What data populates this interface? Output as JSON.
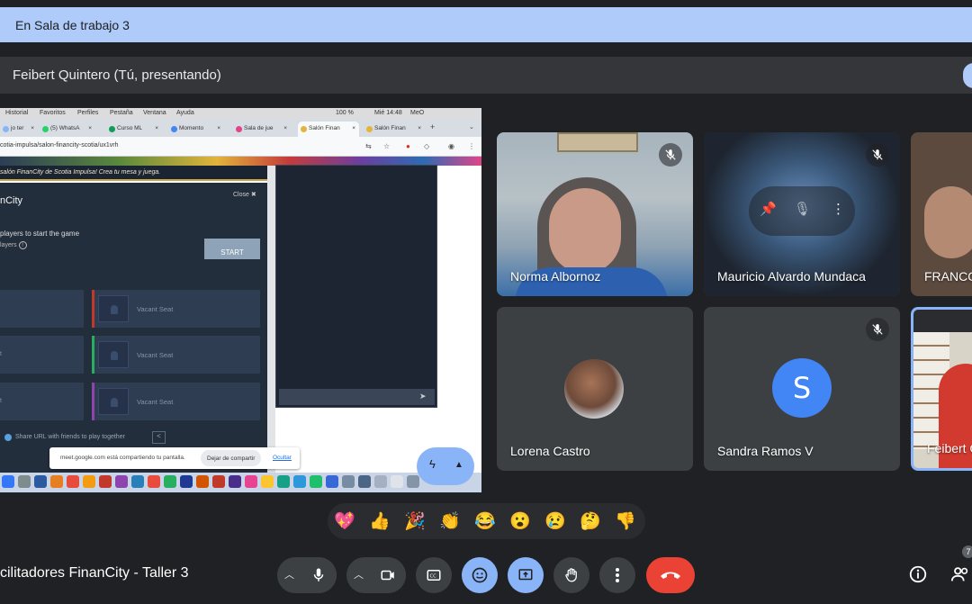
{
  "breakout": {
    "label": "En Sala de trabajo 3"
  },
  "presenter": {
    "label": "Feibert Quintero (Tú, presentando)"
  },
  "shared_screen": {
    "mac_menu": [
      "Historial",
      "Favoritos",
      "Perfiles",
      "Pestaña",
      "Ventana",
      "Ayuda"
    ],
    "mac_status": {
      "battery": "100 %",
      "clock": "Mié 14:48",
      "user": "MeO"
    },
    "tabs": [
      {
        "label": "jo ter",
        "active": false,
        "color": "#8ab4f8"
      },
      {
        "label": "(5) WhatsA",
        "active": false,
        "color": "#25d366"
      },
      {
        "label": "Curso ML",
        "active": false,
        "color": "#0f9d58"
      },
      {
        "label": "Momento",
        "active": false,
        "color": "#4285f4"
      },
      {
        "label": "Sala de jue",
        "active": false,
        "color": "#e0458a"
      },
      {
        "label": "Salón Finan",
        "active": true,
        "color": "#e2b43b"
      },
      {
        "label": "Salón Finan",
        "active": false,
        "color": "#e2b43b"
      }
    ],
    "url": "cotia-impulsa/salon-financity-scotia/ux1vrh",
    "banner": "salón FinanCity de Scotia Impulsa! Crea tu mesa y juega.",
    "panel_title": "nCity",
    "close_label": "Close",
    "players_line1": "players to start the game",
    "players_line2": "layers",
    "start_label": "START",
    "seat_label": "Vacant Seat",
    "left_seat_labels": [
      "",
      "t",
      "t"
    ],
    "seat_colors": [
      "#c0392b",
      "#27ae60",
      "#8e44ad"
    ],
    "share_url_text": "Share URL with friends to play together",
    "meet_notice": {
      "message": "meet.google.com está compartiendo tu pantalla.",
      "stop_label": "Dejar de compartir",
      "hide_label": "Ocultar"
    }
  },
  "participants": [
    {
      "name": "Norma Albornoz",
      "muted": true
    },
    {
      "name": "Mauricio Alvardo Mundaca",
      "muted": true
    },
    {
      "name": "FRANCO",
      "muted": false
    },
    {
      "name": "Lorena Castro",
      "muted": false
    },
    {
      "name": "Sandra Ramos V",
      "muted": true,
      "initial": "S"
    },
    {
      "name": "Feibert Q",
      "muted": false
    }
  ],
  "reactions": [
    "💖",
    "👍",
    "🎉",
    "👏",
    "😂",
    "😮",
    "😢",
    "🤔",
    "👎"
  ],
  "meeting_title": "cilitadores FinanCity - Taller 3",
  "participant_count": "7",
  "colors": {
    "background": "#202124",
    "breakout_bar": "#aecbfa",
    "accent_blue": "#8ab4f8",
    "end_call": "#ea4335",
    "avatar_s": "#4285f4"
  },
  "icons": [
    "chevron-up-icon",
    "mic-icon",
    "camera-icon",
    "captions-icon",
    "emoji-icon",
    "present-icon",
    "raise-hand-icon",
    "more-options-icon",
    "end-call-icon",
    "info-icon",
    "people-icon",
    "mic-off-icon",
    "pin-icon"
  ]
}
